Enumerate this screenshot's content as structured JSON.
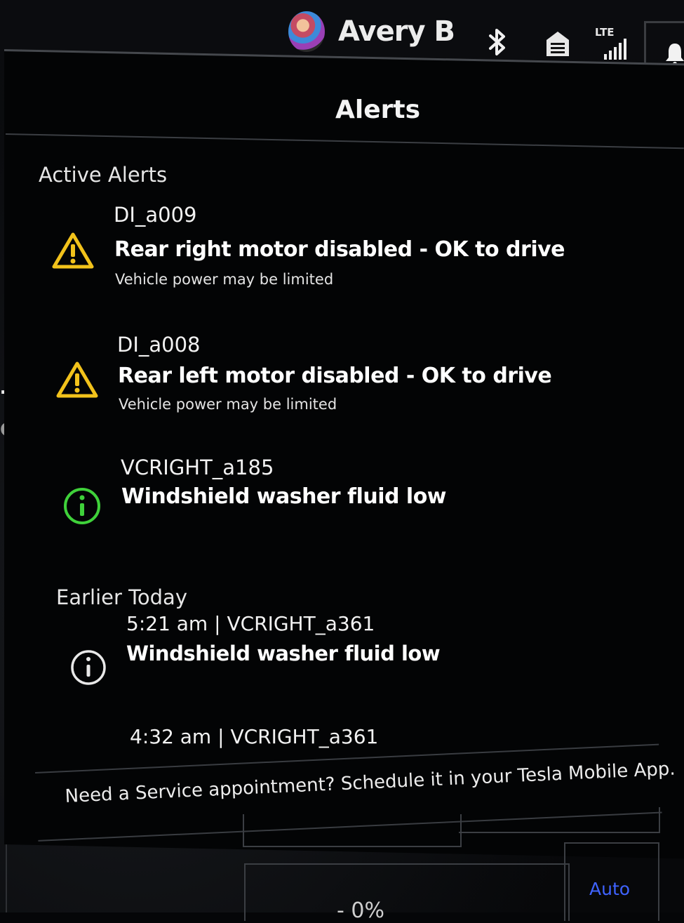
{
  "statusbar": {
    "user_name": "Avery B",
    "network_label": "LTE",
    "icons": [
      "avatar",
      "bluetooth-icon",
      "homelink-icon",
      "lte-signal-icon",
      "bell-icon"
    ]
  },
  "edge": {
    "letter_t": "T",
    "letters_cl": "Cl"
  },
  "panel": {
    "title": "Alerts",
    "active_section": "Active Alerts",
    "earlier_section": "Earlier Today",
    "active_alerts": [
      {
        "code": "DI_a009",
        "message": "Rear right motor disabled - OK to drive",
        "detail": "Vehicle power may be limited",
        "icon": "warning-icon"
      },
      {
        "code": "DI_a008",
        "message": "Rear left motor disabled - OK to drive",
        "detail": "Vehicle power may be limited",
        "icon": "warning-icon"
      },
      {
        "code": "VCRIGHT_a185",
        "message": "Windshield washer fluid low",
        "icon": "info-icon"
      }
    ],
    "earlier_alerts": [
      {
        "code": "5:21 am | VCRIGHT_a361",
        "message": "Windshield washer fluid low",
        "icon": "info-icon"
      },
      {
        "code": "4:32 am | VCRIGHT_a361"
      }
    ],
    "footer": "Need a Service appointment? Schedule it in your Tesla Mobile App."
  },
  "bottom": {
    "auto_label": "Auto",
    "partial_text": "- 0%"
  },
  "colors": {
    "warning": "#f2c21b",
    "info_active": "#3fd13a",
    "info_earlier": "#e8e8e8",
    "auto": "#3f63ff",
    "bell_dot": "#e0262a"
  }
}
